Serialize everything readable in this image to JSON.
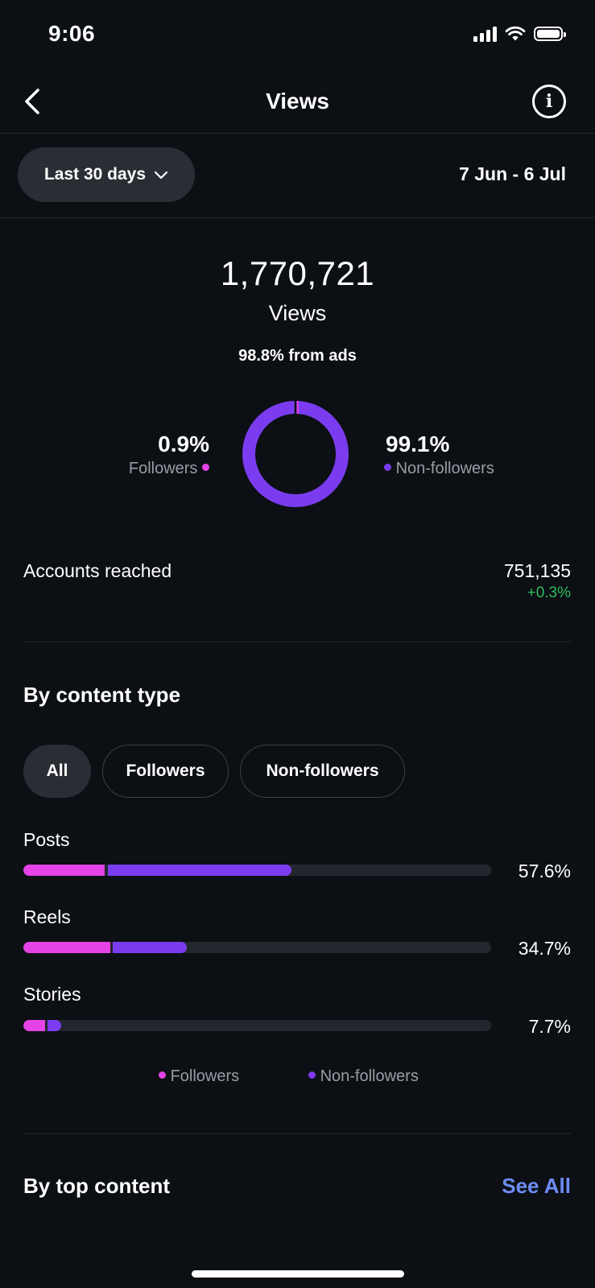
{
  "status_bar": {
    "time": "9:06"
  },
  "header": {
    "title": "Views"
  },
  "filter": {
    "range_label": "Last 30 days",
    "dates": "7 Jun - 6 Jul"
  },
  "summary": {
    "total": "1,770,721",
    "label": "Views",
    "ads_note": "98.8% from ads",
    "followers_pct": "0.9%",
    "followers_label": "Followers",
    "non_followers_pct": "99.1%",
    "non_followers_label": "Non-followers"
  },
  "accounts_reached": {
    "label": "Accounts reached",
    "value": "751,135",
    "change": "+0.3%"
  },
  "by_content_type": {
    "title": "By content type",
    "chips": [
      "All",
      "Followers",
      "Non-followers"
    ],
    "rows": [
      {
        "label": "Posts",
        "percent": "57.6%"
      },
      {
        "label": "Reels",
        "percent": "34.7%"
      },
      {
        "label": "Stories",
        "percent": "7.7%"
      }
    ],
    "legend": {
      "followers": "Followers",
      "non_followers": "Non-followers"
    }
  },
  "by_top_content": {
    "title": "By top content",
    "see_all": "See All"
  },
  "colors": {
    "followers": "#e543e6",
    "non_followers": "#7b3cf0",
    "positive": "#2dbe5f",
    "link": "#6d8cf5",
    "background": "#0c0f14"
  },
  "icons": [
    "signal-icon",
    "wifi-icon",
    "battery-icon",
    "back-chevron-icon",
    "info-icon",
    "chevron-down-icon"
  ]
}
